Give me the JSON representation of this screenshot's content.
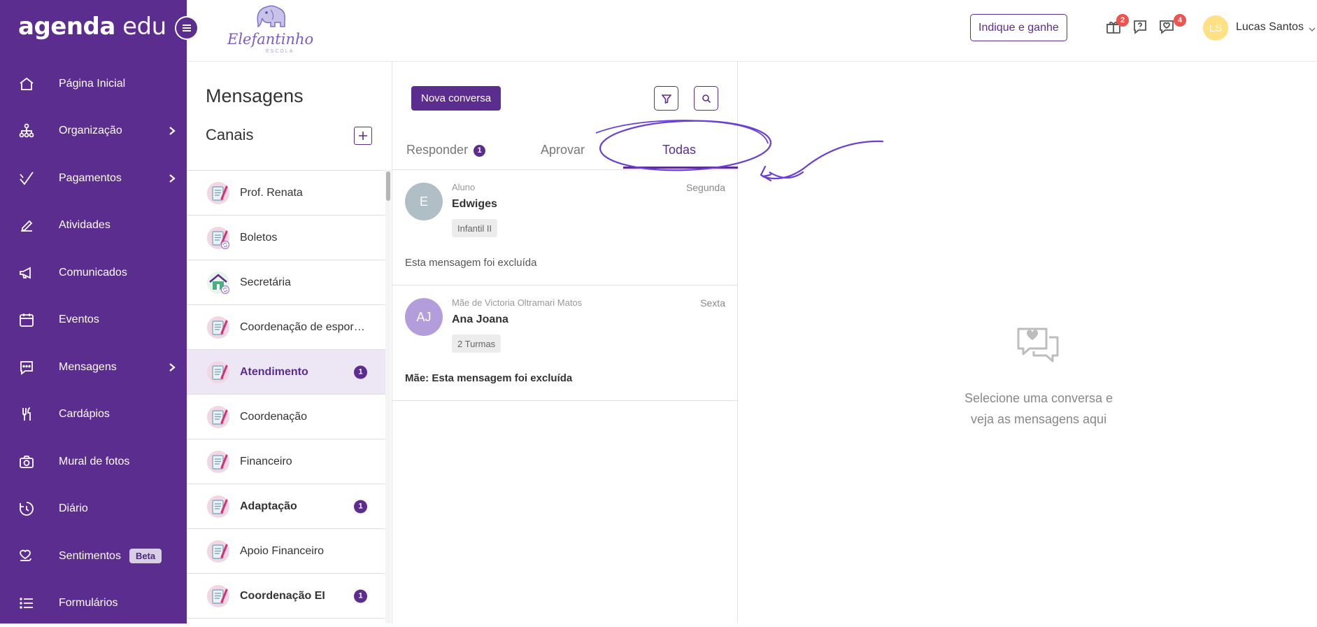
{
  "brand": {
    "part1": "agenda",
    "part2": "edu"
  },
  "school_logo": {
    "name": "Elefantinho",
    "sub": "ESCOLA"
  },
  "sidebar": {
    "items": [
      {
        "label": "Página Inicial",
        "icon": "home-icon",
        "chevron": false
      },
      {
        "label": "Organização",
        "icon": "org-icon",
        "chevron": true
      },
      {
        "label": "Pagamentos",
        "icon": "check-icon",
        "chevron": true
      },
      {
        "label": "Atividades",
        "icon": "pencil-icon",
        "chevron": false
      },
      {
        "label": "Comunicados",
        "icon": "megaphone-icon",
        "chevron": false
      },
      {
        "label": "Eventos",
        "icon": "calendar-icon",
        "chevron": false
      },
      {
        "label": "Mensagens",
        "icon": "chat-icon",
        "chevron": true
      },
      {
        "label": "Cardápios",
        "icon": "cutlery-icon",
        "chevron": false
      },
      {
        "label": "Mural de fotos",
        "icon": "camera-icon",
        "chevron": false
      },
      {
        "label": "Diário",
        "icon": "diary-icon",
        "chevron": false
      },
      {
        "label": "Sentimentos",
        "icon": "feelings-icon",
        "chevron": false,
        "badge": "Beta"
      },
      {
        "label": "Formulários",
        "icon": "list-icon",
        "chevron": false
      }
    ]
  },
  "topbar": {
    "indique": "Indique e ganhe",
    "gift_count": "2",
    "messages_count": "4",
    "user_initials": "LS",
    "user_name": "Lucas Santos"
  },
  "channels": {
    "title": "Mensagens",
    "subtitle": "Canais",
    "items": [
      {
        "label": "Prof. Renata",
        "badge": "",
        "active": false,
        "bold": false,
        "icon": "notepad-icon"
      },
      {
        "label": "Boletos",
        "badge": "",
        "active": false,
        "bold": false,
        "icon": "notepad-sync-icon"
      },
      {
        "label": "Secretária",
        "badge": "",
        "active": false,
        "bold": false,
        "icon": "house-sync-icon"
      },
      {
        "label": "Coordenação de esport...",
        "badge": "",
        "active": false,
        "bold": false,
        "icon": "notepad-icon"
      },
      {
        "label": "Atendimento",
        "badge": "1",
        "active": true,
        "bold": true,
        "icon": "notepad-icon"
      },
      {
        "label": "Coordenação",
        "badge": "",
        "active": false,
        "bold": false,
        "icon": "notepad-icon"
      },
      {
        "label": "Financeiro",
        "badge": "",
        "active": false,
        "bold": false,
        "icon": "notepad-icon"
      },
      {
        "label": "Adaptação",
        "badge": "1",
        "active": false,
        "bold": true,
        "icon": "notepad-icon"
      },
      {
        "label": "Apoio Financeiro",
        "badge": "",
        "active": false,
        "bold": false,
        "icon": "notepad-icon"
      },
      {
        "label": "Coordenação EI",
        "badge": "1",
        "active": false,
        "bold": true,
        "icon": "notepad-icon"
      }
    ]
  },
  "conversations": {
    "new_button": "Nova conversa",
    "tabs": [
      {
        "label": "Responder",
        "badge": "1"
      },
      {
        "label": "Aprovar",
        "badge": ""
      },
      {
        "label": "Todas",
        "badge": ""
      }
    ],
    "active_tab": "Todas",
    "items": [
      {
        "initials": "E",
        "avatar_color": "#b0bec5",
        "role": "Aluno",
        "day": "Segunda",
        "name": "Edwiges",
        "tag": "Infantil II",
        "message": "Esta mensagem foi excluída",
        "bold_message": false
      },
      {
        "initials": "AJ",
        "avatar_color": "#b39ddb",
        "role": "Mãe de Victoria Oltramari Matos",
        "day": "Sexta",
        "name": "Ana Joana",
        "tag": "2 Turmas",
        "message": "Mãe: Esta mensagem foi excluída",
        "bold_message": true
      }
    ]
  },
  "empty_state": {
    "line1": "Selecione uma conversa e",
    "line2": "veja as mensagens aqui"
  },
  "colors": {
    "primary": "#5b2d8e",
    "badge_red": "#ef5350",
    "annotation": "#6a3fd6"
  }
}
